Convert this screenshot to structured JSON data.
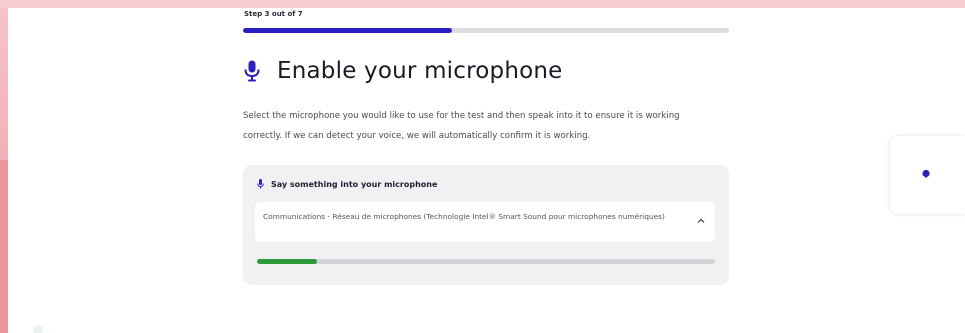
{
  "step": {
    "label": "Step 3 out of 7",
    "progress_fraction": 0.43
  },
  "header": {
    "title": "Enable your microphone",
    "icon": "microphone-icon"
  },
  "description": "Select the microphone you would like to use for the test and then speak into it to ensure it is working correctly. If we can detect your voice, we will automatically confirm it is working.",
  "mic_card": {
    "heading": "Say something into your microphone",
    "icon": "microphone-icon",
    "selected_device": "Communications - Réseau de microphones (Technologie Intel® Smart Sound pour microphones numériques)",
    "level_fraction": 0.13
  },
  "help_button": {
    "icon": "chat-bubble-icon"
  },
  "colors": {
    "accent": "#2a1fc4",
    "level": "#2a9a3a",
    "page_bg": "#f6c9cd"
  }
}
